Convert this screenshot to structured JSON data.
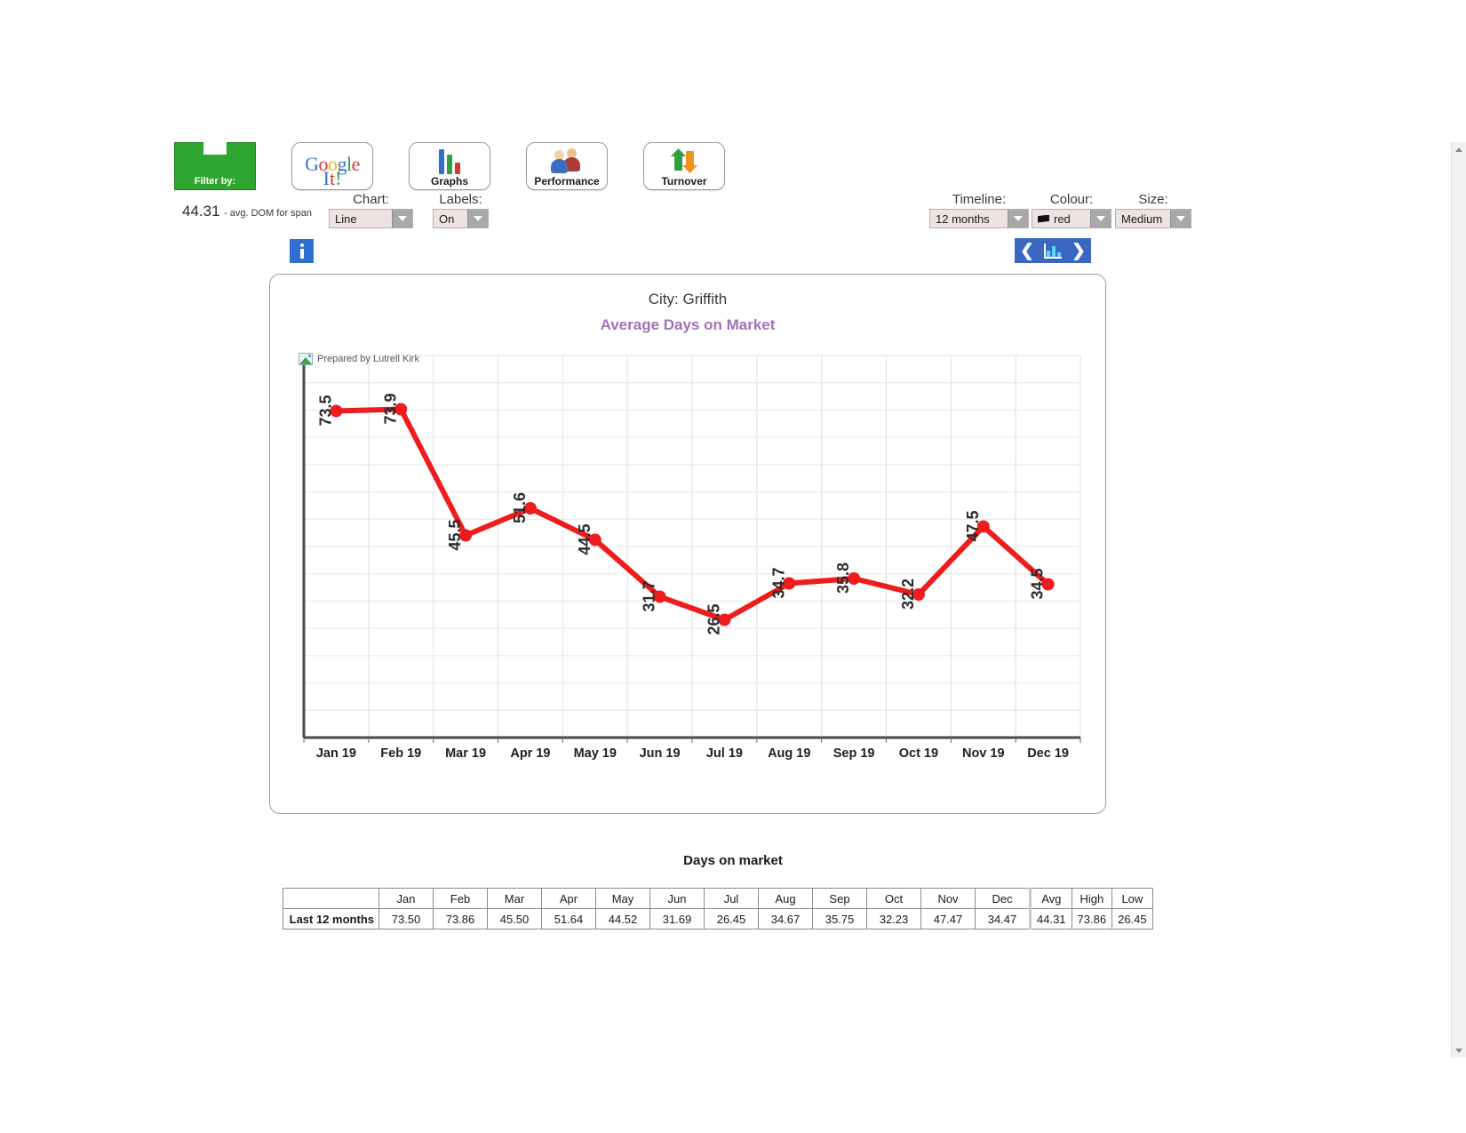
{
  "toolbar": {
    "buttons": [
      {
        "name": "filter-by",
        "label": "Filter by:"
      },
      {
        "name": "google-it",
        "label": "It!",
        "brand": "Google"
      },
      {
        "name": "graphs",
        "label": "Graphs"
      },
      {
        "name": "performance",
        "label": "Performance"
      },
      {
        "name": "turnover",
        "label": "Turnover"
      }
    ]
  },
  "summary": {
    "value": "44.31",
    "caption": "- avg. DOM for span"
  },
  "controls": {
    "chart": {
      "label": "Chart:",
      "value": "Line"
    },
    "labels": {
      "label": "Labels:",
      "value": "On"
    },
    "timeline": {
      "label": "Timeline:",
      "value": "12 months"
    },
    "colour": {
      "label": "Colour:",
      "value": "red",
      "swatch_hex": "#111111"
    },
    "size": {
      "label": "Size:",
      "value": "Medium"
    }
  },
  "nav": {
    "prev": "❮",
    "next": "❯"
  },
  "card": {
    "city_line": "City: Griffith",
    "title": "Average Days on Market",
    "title_color": "#a070b8",
    "watermark": "Prepared by Lutrell Kirk"
  },
  "chart_data": {
    "type": "line",
    "title": "Average Days on Market",
    "subtitle": "City: Griffith",
    "xlabel": "",
    "ylabel": "",
    "x": [
      "Jan 19",
      "Feb 19",
      "Mar 19",
      "Apr 19",
      "May 19",
      "Jun 19",
      "Jul 19",
      "Aug 19",
      "Sep 19",
      "Oct 19",
      "Nov 19",
      "Dec 19"
    ],
    "values": [
      73.5,
      73.9,
      45.5,
      51.6,
      44.5,
      31.7,
      26.5,
      34.7,
      35.8,
      32.2,
      47.5,
      34.5
    ],
    "point_labels": [
      "73.5",
      "73.9",
      "45.5",
      "51.6",
      "44.5",
      "31.7",
      "26.5",
      "34.7",
      "35.8",
      "32.2",
      "47.5",
      "34.5"
    ],
    "series_color": "#ee1c1c",
    "ylim": [
      0,
      86
    ],
    "grid": true,
    "legend": "none",
    "labels_rotated": true
  },
  "table": {
    "title": "Days on market",
    "columns": [
      "",
      "Jan",
      "Feb",
      "Mar",
      "Apr",
      "May",
      "Jun",
      "Jul",
      "Aug",
      "Sep",
      "Oct",
      "Nov",
      "Dec",
      "Avg",
      "High",
      "Low"
    ],
    "rows": [
      {
        "header": "Last 12 months",
        "cells": [
          "73.50",
          "73.86",
          "45.50",
          "51.64",
          "44.52",
          "31.69",
          "26.45",
          "34.67",
          "35.75",
          "32.23",
          "47.47",
          "34.47"
        ],
        "avg": "44.31",
        "high": "73.86",
        "low": "26.45"
      }
    ]
  }
}
